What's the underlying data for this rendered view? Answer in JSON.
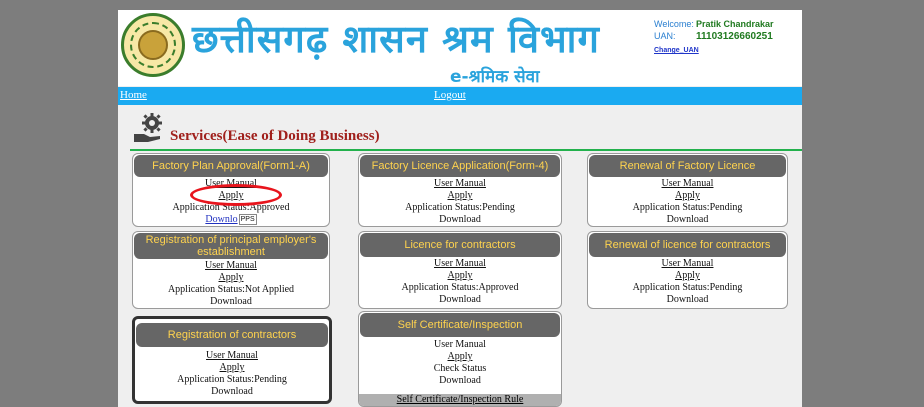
{
  "header": {
    "title": "छत्तीसगढ़ शासन श्रम विभाग",
    "subtitle": "e-श्रमिक सेवा",
    "welcome_label": "Welcome:",
    "user_name": "Pratik Chandrakar",
    "uan_label": "UAN:",
    "uan_value": "11103126660251",
    "change_uan": "Change_UAN"
  },
  "nav": {
    "home": "Home",
    "logout": "Logout"
  },
  "services": {
    "title": "Services(Ease of Doing Business)"
  },
  "cards": {
    "factory_plan": {
      "title": "Factory Plan Approval(Form1-A)",
      "manual": "User Manual",
      "apply": "Apply",
      "status": "Application Status:Approved",
      "download": "Downlo",
      "tooltip": "PPS"
    },
    "factory_licence": {
      "title": "Factory Licence Application(Form-4)",
      "manual": "User Manual",
      "apply": "Apply",
      "status": "Application Status:Pending",
      "download": "Download"
    },
    "renewal_factory": {
      "title": "Renewal of Factory Licence",
      "manual": "User Manual",
      "apply": "Apply",
      "status": "Application Status:Pending",
      "download": "Download"
    },
    "principal_employer": {
      "title": "Registration of principal employer's establishment",
      "manual": "User Manual",
      "apply": "Apply",
      "status": "Application Status:Not Applied",
      "download": "Download"
    },
    "licence_contractors": {
      "title": "Licence for contractors",
      "manual": "User Manual",
      "apply": "Apply",
      "status": "Application Status:Approved",
      "download": "Download"
    },
    "renewal_contractors": {
      "title": "Renewal of licence for contractors",
      "manual": "User Manual",
      "apply": "Apply",
      "status": "Application Status:Pending",
      "download": "Download"
    },
    "reg_contractors": {
      "title": "Registration of contractors",
      "manual": "User Manual",
      "apply": "Apply",
      "status": "Application Status:Pending",
      "download": "Download"
    },
    "self_cert": {
      "title": "Self Certificate/Inspection",
      "manual": "User Manual",
      "apply": "Apply",
      "check": "Check Status",
      "download": "Download",
      "rule": "Self Certificate/Inspection Rule"
    }
  },
  "colors": {
    "nav": "#1aaaf1",
    "title": "#2aa3dc",
    "card_header": "#666666",
    "card_header_text": "#ffd34e",
    "highlight": "#e8141c"
  }
}
